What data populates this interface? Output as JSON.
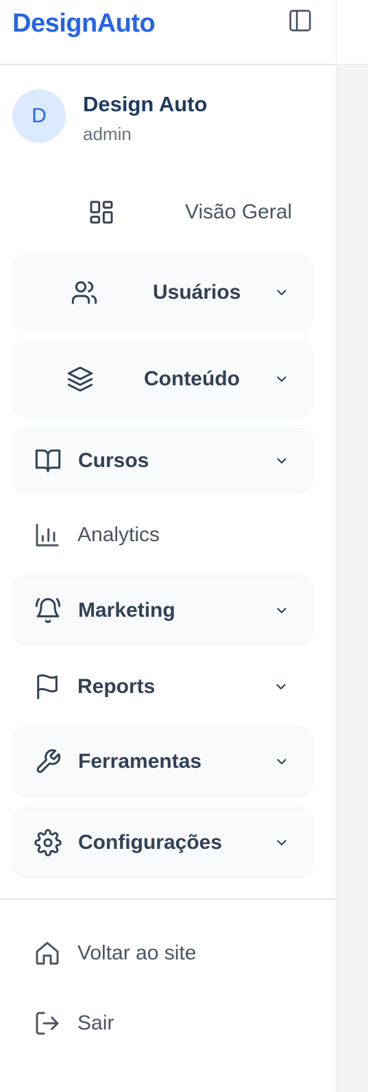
{
  "app": {
    "logo": "DesignAuto"
  },
  "header": {
    "collapse_icon": "sidebar-toggle-icon"
  },
  "user": {
    "avatar_initial": "D",
    "name": "Design Auto",
    "role": "admin"
  },
  "nav": {
    "overview": {
      "label": "Visão Geral",
      "icon": "layout-grid-icon"
    },
    "users": {
      "label": "Usuários",
      "icon": "users-icon"
    },
    "content": {
      "label": "Conteúdo",
      "icon": "layers-icon"
    },
    "courses": {
      "label": "Cursos",
      "icon": "book-open-icon"
    },
    "analytics": {
      "label": "Analytics",
      "icon": "bar-chart-icon"
    },
    "marketing": {
      "label": "Marketing",
      "icon": "bell-ring-icon"
    },
    "reports": {
      "label": "Reports",
      "icon": "flag-icon"
    },
    "tools": {
      "label": "Ferramentas",
      "icon": "wrench-icon"
    },
    "settings": {
      "label": "Configurações",
      "icon": "gear-icon"
    }
  },
  "footer": {
    "back_to_site": {
      "label": "Voltar ao site",
      "icon": "home-icon"
    },
    "logout": {
      "label": "Sair",
      "icon": "log-out-icon"
    }
  },
  "colors": {
    "brand": "#2563eb",
    "avatar_bg": "#dbeafe",
    "user_name": "#1e3a5f"
  }
}
